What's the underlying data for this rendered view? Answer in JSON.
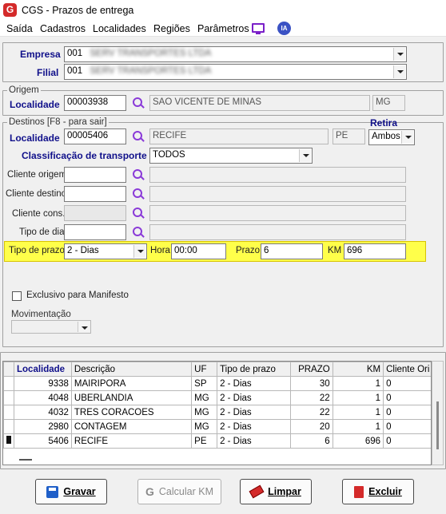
{
  "window": {
    "title": "CGS - Prazos de entrega",
    "icon_letter": "G"
  },
  "menu": {
    "items": [
      "Saída",
      "Cadastros",
      "Localidades",
      "Regiões",
      "Parâmetros"
    ],
    "ia_label": "IA"
  },
  "empresa": {
    "label": "Empresa",
    "code": "001",
    "name": "SERV TRANSPORTES LTDA"
  },
  "filial": {
    "label": "Filial",
    "code": "001",
    "name": "SERV TRANSPORTES LTDA"
  },
  "origem": {
    "title": "Origem",
    "localidade_label": "Localidade",
    "code": "00003938",
    "city": "SAO VICENTE DE MINAS",
    "uf": "MG"
  },
  "destinos": {
    "title": "Destinos  [F8 - para sair]",
    "retira_label": "Retira",
    "retira_value": "Ambos",
    "localidade_label": "Localidade",
    "code": "00005406",
    "city": "RECIFE",
    "uf": "PE",
    "classificacao_label": "Classificação de transporte",
    "classificacao_value": "TODOS",
    "cliente_origem_label": "Cliente origem",
    "cliente_destino_label": "Cliente destino",
    "cliente_cons_label": "Cliente cons.",
    "tipo_dia_label": "Tipo de dia",
    "tipo_prazo_label": "Tipo de prazo",
    "tipo_prazo_value": "2 - Dias",
    "hora_label": "Hora",
    "hora_value": "00:00",
    "prazo_label": "Prazo",
    "prazo_value": "6",
    "km_label": "KM",
    "km_value": "696",
    "exclusivo_label": "Exclusivo para Manifesto",
    "movimentacao_label": "Movimentação"
  },
  "grid": {
    "headers": [
      "Localidade",
      "Descrição",
      "UF",
      "Tipo de prazo",
      "PRAZO",
      "KM",
      "Cliente Ori"
    ],
    "rows": [
      [
        "9338",
        "MAIRIPORA",
        "SP",
        "2 - Dias",
        "30",
        "1",
        "0"
      ],
      [
        "4048",
        "UBERLANDIA",
        "MG",
        "2 - Dias",
        "22",
        "1",
        "0"
      ],
      [
        "4032",
        "TRES CORACOES",
        "MG",
        "2 - Dias",
        "22",
        "1",
        "0"
      ],
      [
        "2980",
        "CONTAGEM",
        "MG",
        "2 - Dias",
        "20",
        "1",
        "0"
      ],
      [
        "5406",
        "RECIFE",
        "PE",
        "2 - Dias",
        "6",
        "696",
        "0"
      ]
    ]
  },
  "buttons": {
    "gravar": "Gravar",
    "calcular": "Calcular KM",
    "limpar": "Limpar",
    "excluir": "Excluir"
  },
  "colors": {
    "accent": "#7a1fc8",
    "highlight": "#ffff4a",
    "label_blue": "#10108a"
  }
}
